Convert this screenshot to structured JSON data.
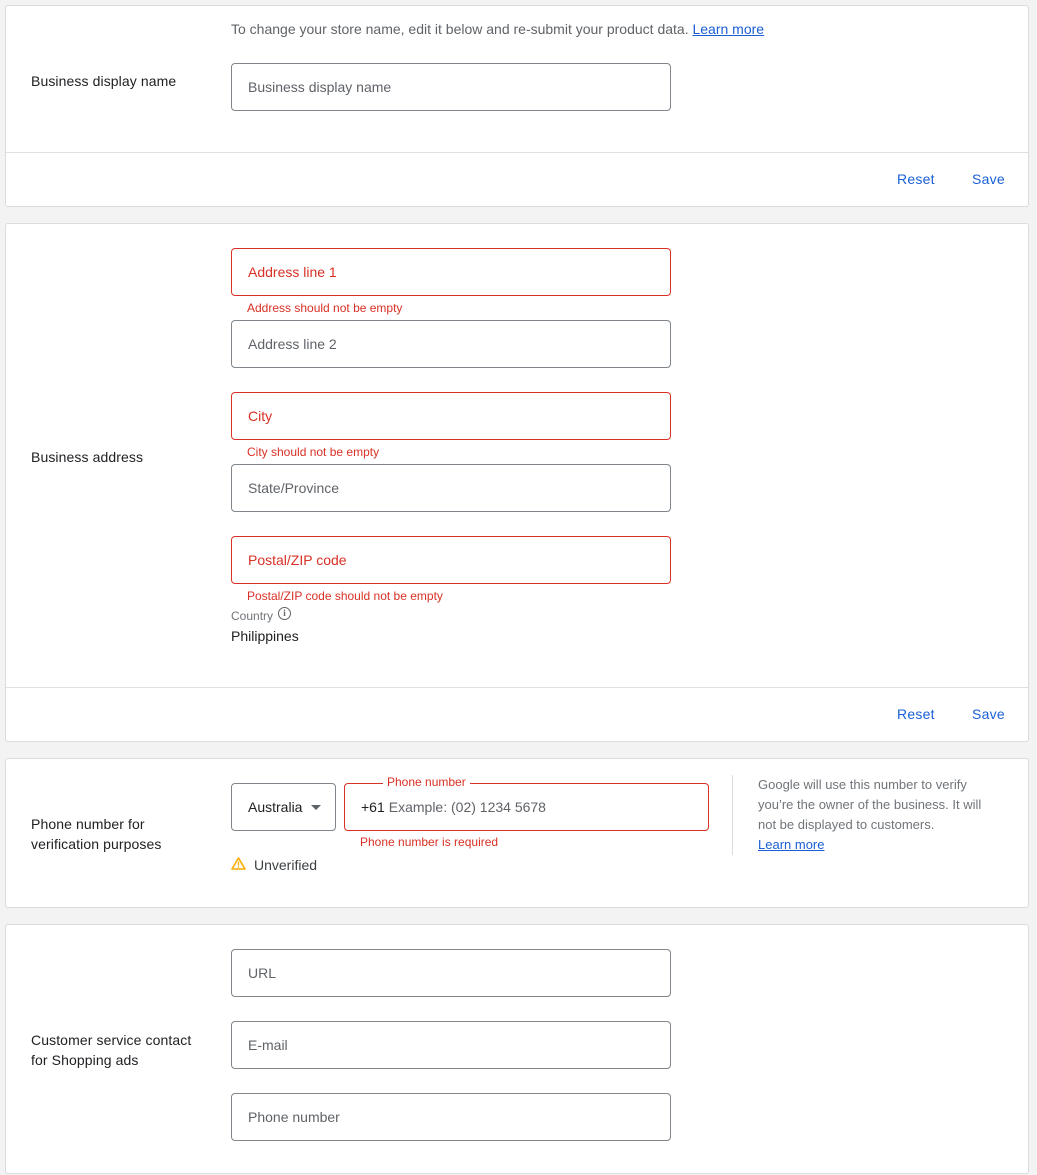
{
  "colors": {
    "accent": "#1a5fd6",
    "error": "#d93025",
    "warning": "#f9ab00",
    "background": "#f3f3f3"
  },
  "display_name_section": {
    "label": "Business display name",
    "helper_text": "To change your store name, edit it below and re-submit your product data.",
    "helper_link": "Learn more",
    "input_placeholder": "Business display name",
    "input_value": "",
    "reset_label": "Reset",
    "save_label": "Save"
  },
  "address_section": {
    "label": "Business address",
    "fields": {
      "address1": {
        "placeholder": "Address line 1",
        "value": "",
        "error": "Address should not be empty"
      },
      "address2": {
        "placeholder": "Address line 2",
        "value": ""
      },
      "city": {
        "placeholder": "City",
        "value": "",
        "error": "City should not be empty"
      },
      "state": {
        "placeholder": "State/Province",
        "value": ""
      },
      "postal": {
        "placeholder": "Postal/ZIP code",
        "value": "",
        "error": "Postal/ZIP code should not be empty"
      }
    },
    "country_label": "Country",
    "country_icon": "info-icon",
    "country_value": "Philippines",
    "reset_label": "Reset",
    "save_label": "Save"
  },
  "phone_section": {
    "label_line1": "Phone number for",
    "label_line2": "verification purposes",
    "country_select": "Australia",
    "phone_label": "Phone number",
    "phone_prefix": "+61",
    "phone_placeholder": "Example: (02) 1234 5678",
    "phone_value": "",
    "phone_error": "Phone number is required",
    "status_icon": "warning-icon",
    "status_text": "Unverified",
    "note_text": "Google will use this number to verify you’re the owner of the business. It will not be displayed to customers.",
    "note_link": "Learn more"
  },
  "customer_service_section": {
    "label_line1": "Customer service contact",
    "label_line2": "for Shopping ads",
    "fields": {
      "url": {
        "placeholder": "URL",
        "value": ""
      },
      "email": {
        "placeholder": "E-mail",
        "value": ""
      },
      "phone": {
        "placeholder": "Phone number",
        "value": ""
      }
    }
  }
}
